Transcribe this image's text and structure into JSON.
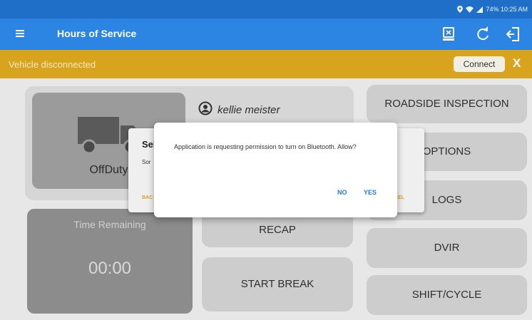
{
  "status_bar": {
    "text": "74% 10:25 AM",
    "icons": [
      "location-icon",
      "wifi-icon",
      "signal-icon",
      "battery-icon"
    ]
  },
  "app_bar": {
    "title": "Hours of Service",
    "icons": [
      "menu-icon",
      "eld-device-icon",
      "refresh-icon",
      "logout-icon"
    ],
    "color": "#2c85e2"
  },
  "banner": {
    "text": "Vehicle disconnected",
    "connect_label": "Connect",
    "close_label": "X",
    "color": "#d8a41d"
  },
  "duty": {
    "status": "OffDuty",
    "icon": "truck-icon"
  },
  "user": {
    "name": "kellie meister",
    "icon": "account-circle-icon"
  },
  "time": {
    "label": "Time Remaining",
    "value": "00:00"
  },
  "buttons": {
    "roadside_inspection": "ROADSIDE INSPECTION",
    "options": "OPTIONS",
    "logs": "LOGS",
    "recap": "RECAP",
    "dvir": "DVIR",
    "start_break": "START BREAK",
    "shift_cycle": "SHIFT/CYCLE"
  },
  "background_dialog": {
    "title": "Sel",
    "message": "Sor",
    "left_action": "BAC",
    "right_action": "CEL"
  },
  "permission_dialog": {
    "message": "Application is requesting permission to turn on Bluetooth. Allow?",
    "no_label": "NO",
    "yes_label": "YES"
  }
}
